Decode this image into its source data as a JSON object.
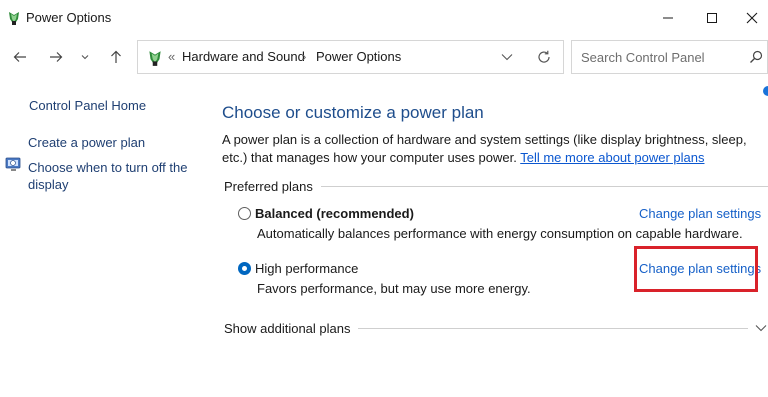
{
  "window": {
    "title": "Power Options"
  },
  "nav": {
    "breadcrumb_sep": "«",
    "crumbs": [
      "Hardware and Sound",
      "Power Options"
    ],
    "crumb_divider": "›",
    "search_placeholder": "Search Control Panel"
  },
  "sidebar": {
    "items": [
      {
        "label": "Control Panel Home"
      },
      {
        "label": "Create a power plan"
      },
      {
        "label": "Choose when to turn off the display"
      }
    ]
  },
  "main": {
    "heading": "Choose or customize a power plan",
    "description": "A power plan is a collection of hardware and system settings (like display brightness, sleep, etc.) that manages how your computer uses power.",
    "learn_more": "Tell me more about power plans",
    "preferred_label": "Preferred plans",
    "plans": [
      {
        "name": "Balanced (recommended)",
        "description": "Automatically balances performance with energy consumption on capable hardware.",
        "link": "Change plan settings",
        "selected": false
      },
      {
        "name": "High performance",
        "description": "Favors performance, but may use more energy.",
        "link": "Change plan settings",
        "selected": true
      }
    ],
    "additional_label": "Show additional plans"
  },
  "colors": {
    "heading": "#1e4d8c",
    "link": "#1660c8",
    "highlight": "#d9222a",
    "radio_selected": "#0067c0"
  }
}
